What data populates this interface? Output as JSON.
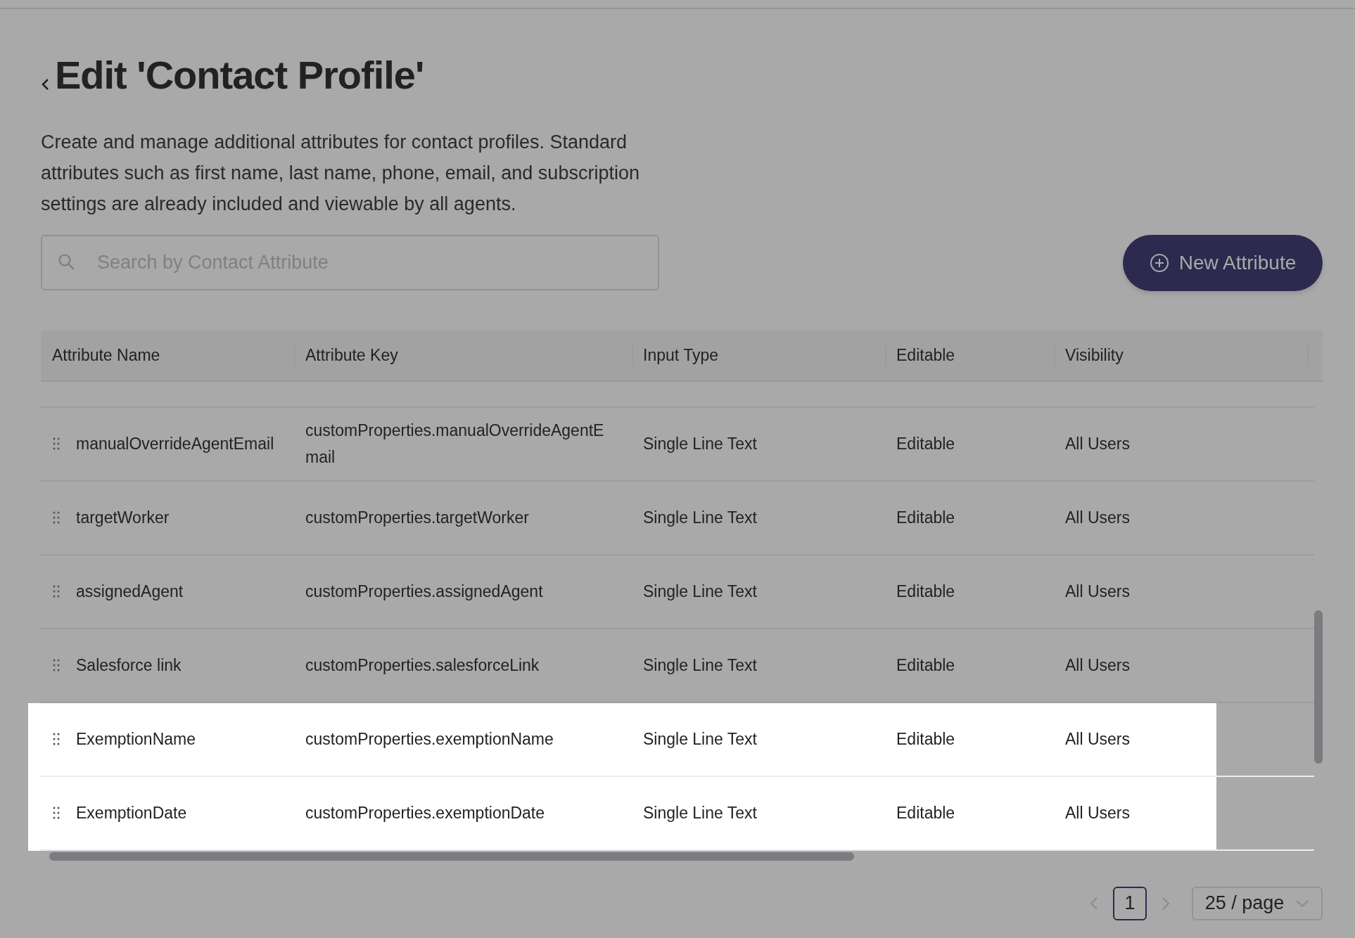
{
  "page": {
    "title": "Edit 'Contact Profile'",
    "description": "Create and manage additional attributes for contact profiles. Standard attributes such as first name, last name, phone, email, and subscription settings are already included and viewable by all agents."
  },
  "search": {
    "placeholder": "Search by Contact Attribute"
  },
  "new_button": {
    "label": "New Attribute"
  },
  "table": {
    "columns": [
      "Attribute Name",
      "Attribute Key",
      "Input Type",
      "Editable",
      "Visibility"
    ],
    "rows": [
      {
        "name": "manualOverrideAgentEmail",
        "key": "customProperties.manualOverrideAgentEmail",
        "input_type": "Single Line Text",
        "editable": "Editable",
        "visibility": "All Users",
        "highlighted": false
      },
      {
        "name": "targetWorker",
        "key": "customProperties.targetWorker",
        "input_type": "Single Line Text",
        "editable": "Editable",
        "visibility": "All Users",
        "highlighted": false
      },
      {
        "name": "assignedAgent",
        "key": "customProperties.assignedAgent",
        "input_type": "Single Line Text",
        "editable": "Editable",
        "visibility": "All Users",
        "highlighted": false
      },
      {
        "name": "Salesforce link",
        "key": "customProperties.salesforceLink",
        "input_type": "Single Line Text",
        "editable": "Editable",
        "visibility": "All Users",
        "highlighted": false
      },
      {
        "name": "ExemptionName",
        "key": "customProperties.exemptionName",
        "input_type": "Single Line Text",
        "editable": "Editable",
        "visibility": "All Users",
        "highlighted": true
      },
      {
        "name": "ExemptionDate",
        "key": "customProperties.exemptionDate",
        "input_type": "Single Line Text",
        "editable": "Editable",
        "visibility": "All Users",
        "highlighted": true
      }
    ]
  },
  "pagination": {
    "pages": [
      {
        "label": "1",
        "selected": true
      }
    ],
    "page_size": "25 / page"
  }
}
